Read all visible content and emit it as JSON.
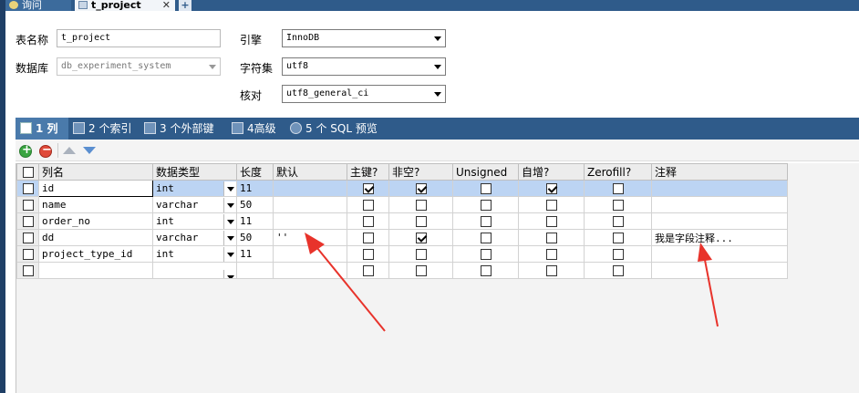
{
  "tabs": {
    "query_label": "询问",
    "project_label": "t_project",
    "close": "✕",
    "add": "+"
  },
  "form": {
    "table_name_label": "表名称",
    "table_name_value": "t_project",
    "database_label": "数据库",
    "database_value": "db_experiment_system",
    "engine_label": "引擎",
    "engine_value": "InnoDB",
    "charset_label": "字符集",
    "charset_value": "utf8",
    "collation_label": "核对",
    "collation_value": "utf8_general_ci"
  },
  "subtabs": [
    {
      "label": "1 列"
    },
    {
      "label": "2 个索引"
    },
    {
      "label": "3 个外部键"
    },
    {
      "label": "4高级"
    },
    {
      "label": "5 个 SQL 预览"
    }
  ],
  "grid": {
    "headers": {
      "name": "列名",
      "type": "数据类型",
      "length": "长度",
      "default": "默认",
      "pk": "主键?",
      "not_null": "非空?",
      "unsigned": "Unsigned",
      "auto_inc": "自增?",
      "zerofill": "Zerofill?",
      "comment": "注释"
    },
    "rows": [
      {
        "name": "id",
        "type": "int",
        "length": "11",
        "default": "",
        "pk": true,
        "not_null": true,
        "unsigned": false,
        "auto_inc": true,
        "zerofill": false,
        "comment": ""
      },
      {
        "name": "name",
        "type": "varchar",
        "length": "50",
        "default": "",
        "pk": false,
        "not_null": false,
        "unsigned": false,
        "auto_inc": false,
        "zerofill": false,
        "comment": ""
      },
      {
        "name": "order_no",
        "type": "int",
        "length": "11",
        "default": "",
        "pk": false,
        "not_null": false,
        "unsigned": false,
        "auto_inc": false,
        "zerofill": false,
        "comment": ""
      },
      {
        "name": "dd",
        "type": "varchar",
        "length": "50",
        "default": "''",
        "pk": false,
        "not_null": true,
        "unsigned": false,
        "auto_inc": false,
        "zerofill": false,
        "comment": "我是字段注释..."
      },
      {
        "name": "project_type_id",
        "type": "int",
        "length": "11",
        "default": "",
        "pk": false,
        "not_null": false,
        "unsigned": false,
        "auto_inc": false,
        "zerofill": false,
        "comment": ""
      },
      {
        "name": "",
        "type": "",
        "length": "",
        "default": "",
        "pk": false,
        "not_null": false,
        "unsigned": false,
        "auto_inc": false,
        "zerofill": false,
        "comment": ""
      }
    ]
  },
  "colors": {
    "tab_bar": "#2f5b8a",
    "selected_row": "#bcd4f3",
    "annotation_arrow": "#e8332b"
  }
}
